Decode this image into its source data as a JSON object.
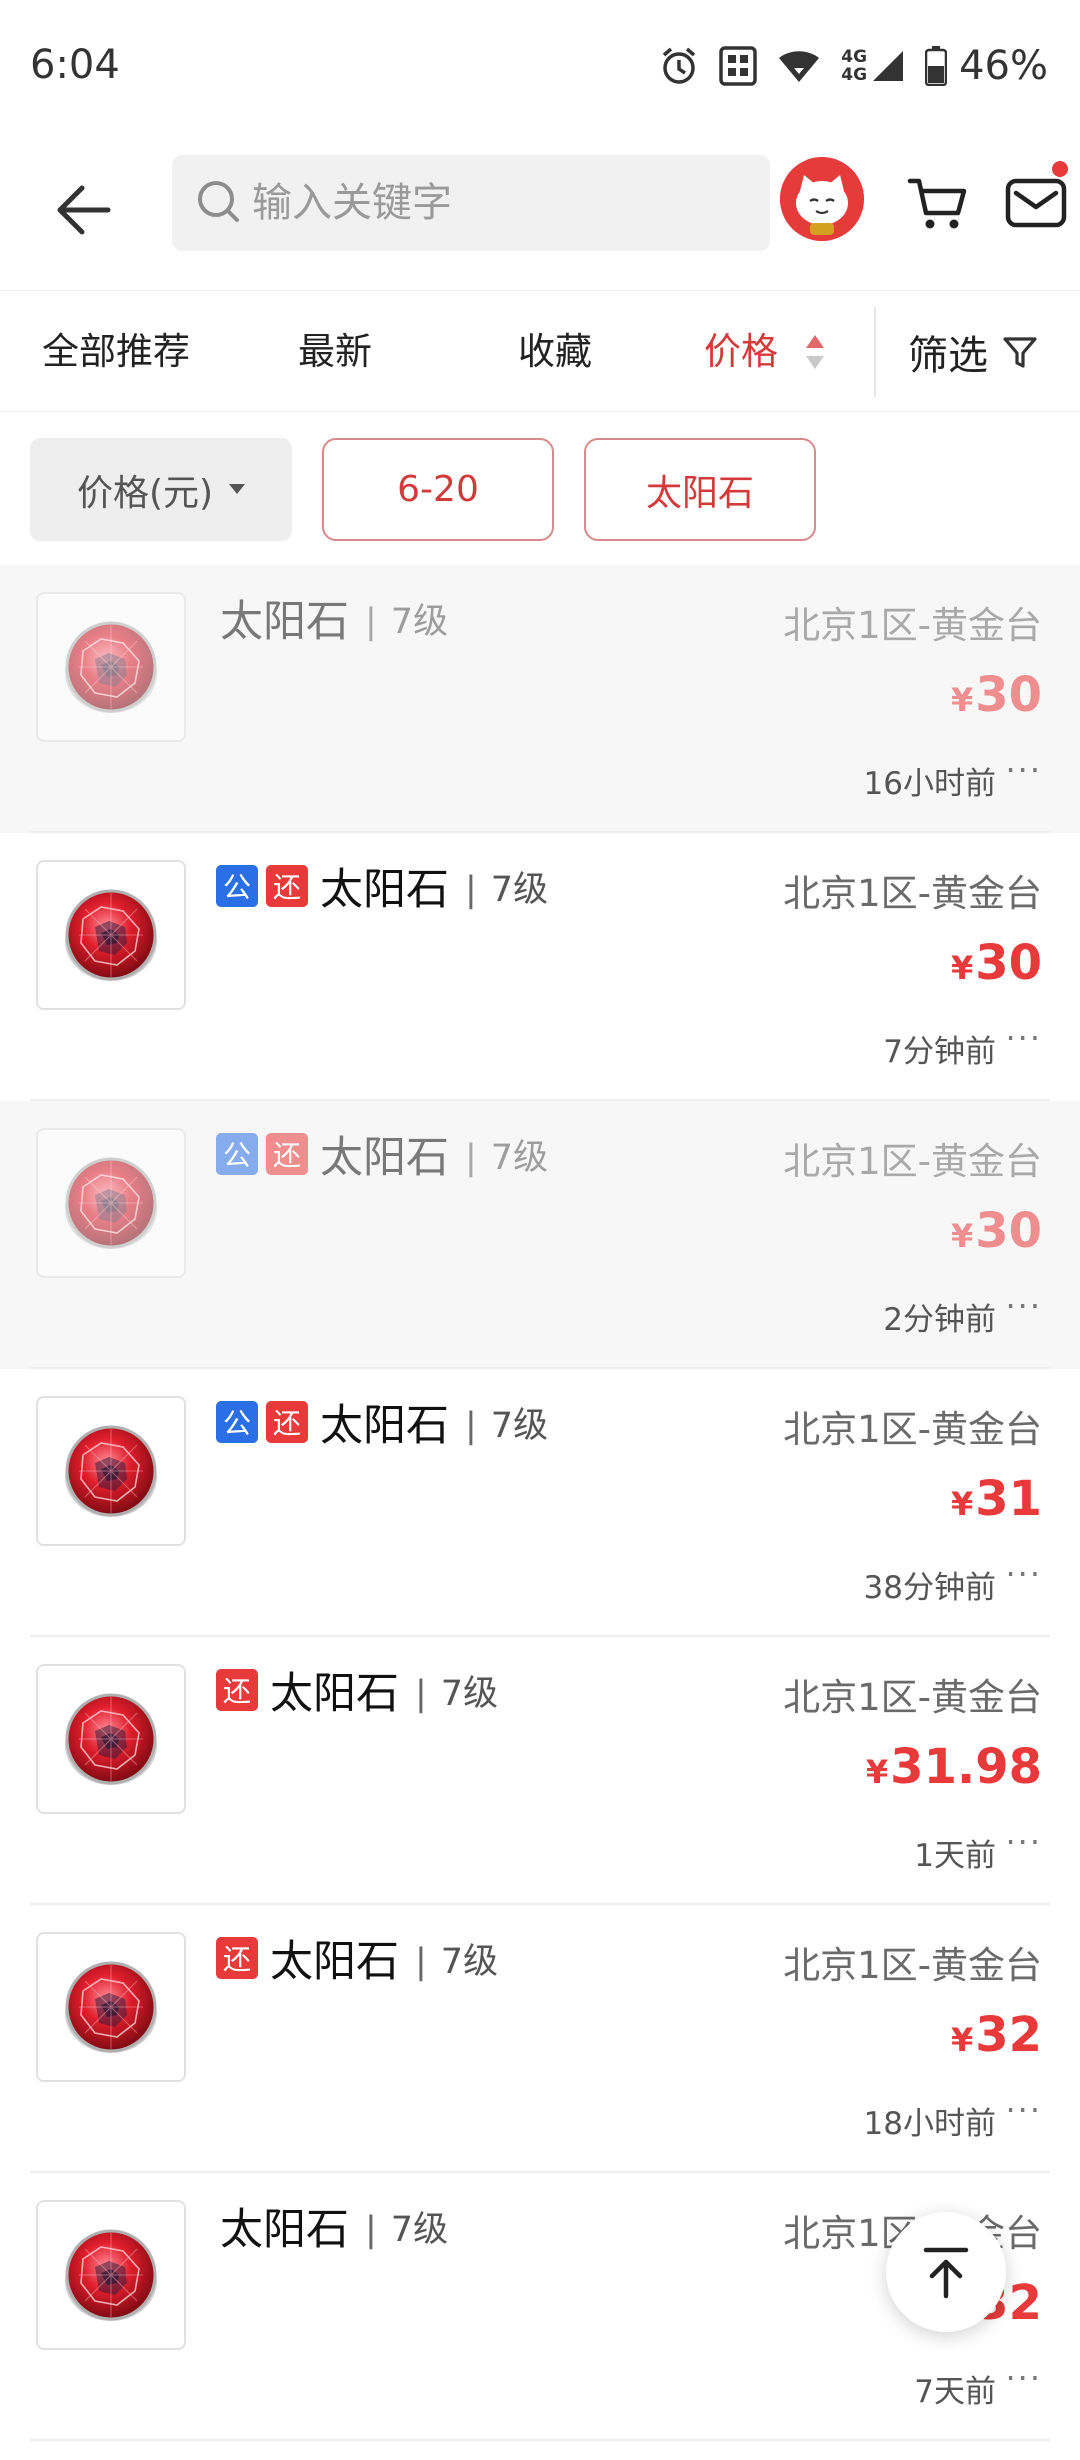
{
  "status_bar": {
    "time": "6:04",
    "network_label": "4G",
    "battery": "46%",
    "icons": [
      "alarm-icon",
      "nfc-icon",
      "wifi-icon",
      "signal-icon",
      "battery-icon"
    ]
  },
  "top_nav": {
    "search_placeholder": "输入关键字",
    "icons": [
      "back-arrow-icon",
      "search-icon",
      "cart-icon",
      "mail-icon"
    ],
    "has_unread_mail": true
  },
  "sort_tabs": {
    "items": [
      {
        "label": "全部推荐",
        "active": false
      },
      {
        "label": "最新",
        "active": false
      },
      {
        "label": "收藏",
        "active": false
      },
      {
        "label": "价格",
        "active": true
      }
    ],
    "filter_label": "筛选",
    "accent_color": "#d33b3b"
  },
  "chips": {
    "price_selector": "价格(元)",
    "active_filters": [
      "6-20",
      "太阳石"
    ]
  },
  "listings": [
    {
      "name": "太阳石",
      "level": "7级",
      "badges": [],
      "server": "北京1区-黄金台",
      "currency": "¥",
      "price": "30",
      "time": "16小时前",
      "dimmed": true
    },
    {
      "name": "太阳石",
      "level": "7级",
      "badges": [
        "公",
        "还"
      ],
      "server": "北京1区-黄金台",
      "currency": "¥",
      "price": "30",
      "time": "7分钟前",
      "dimmed": false
    },
    {
      "name": "太阳石",
      "level": "7级",
      "badges": [
        "公",
        "还"
      ],
      "server": "北京1区-黄金台",
      "currency": "¥",
      "price": "30",
      "time": "2分钟前",
      "dimmed": true
    },
    {
      "name": "太阳石",
      "level": "7级",
      "badges": [
        "公",
        "还"
      ],
      "server": "北京1区-黄金台",
      "currency": "¥",
      "price": "31",
      "time": "38分钟前",
      "dimmed": false
    },
    {
      "name": "太阳石",
      "level": "7级",
      "badges": [
        "还"
      ],
      "server": "北京1区-黄金台",
      "currency": "¥",
      "price": "31.98",
      "time": "1天前",
      "dimmed": false
    },
    {
      "name": "太阳石",
      "level": "7级",
      "badges": [
        "还"
      ],
      "server": "北京1区-黄金台",
      "currency": "¥",
      "price": "32",
      "time": "18小时前",
      "dimmed": false
    },
    {
      "name": "太阳石",
      "level": "7级",
      "badges": [],
      "server": "北京1区-黄金台",
      "currency": "¥",
      "price": "32",
      "time": "7天前",
      "dimmed": false
    }
  ],
  "more_glyph": "···",
  "colors": {
    "price": "#e83a3a",
    "badge_gong": "#2b6fe6",
    "badge_huan": "#e83a3a"
  }
}
